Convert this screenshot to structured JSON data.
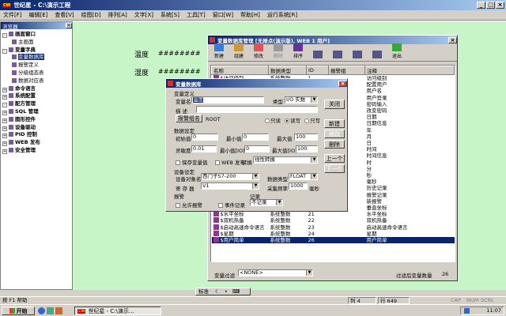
{
  "app": {
    "title": "世纪星 - C:\\演示工程",
    "title_icon": "cw-icon"
  },
  "menu": [
    "文件[F]",
    "编辑[E]",
    "查看[V]",
    "绘图[D]",
    "排列[A]",
    "文字[X]",
    "系统[S]",
    "工具[T]",
    "窗口[W]",
    "帮助[H]",
    "运行系统[R]"
  ],
  "browser": {
    "title": "浏览器",
    "items": [
      {
        "label": "画面窗口",
        "level": 0,
        "bold": true,
        "exp": "-"
      },
      {
        "label": "主画面",
        "level": 1
      },
      {
        "label": "变量字典",
        "level": 0,
        "bold": true,
        "exp": "-"
      },
      {
        "label": "变量数据库",
        "level": 1
      },
      {
        "label": "报警定义",
        "level": 1
      },
      {
        "label": "分级组态表",
        "level": 1
      },
      {
        "label": "数据对应表",
        "level": 1
      },
      {
        "label": "命令语言",
        "level": 0,
        "bold": true,
        "exp": "+"
      },
      {
        "label": "系统配置",
        "level": 0,
        "bold": true,
        "exp": "+"
      },
      {
        "label": "配方管理",
        "level": 0,
        "bold": true,
        "exp": "-"
      },
      {
        "label": "SQL 管理",
        "level": 0,
        "bold": true,
        "exp": "+"
      },
      {
        "label": "图形控件",
        "level": 0,
        "bold": true,
        "exp": "+"
      },
      {
        "label": "设备驱动",
        "level": 0,
        "bold": true,
        "exp": "+"
      },
      {
        "label": "PID 控制",
        "level": 0,
        "bold": true,
        "exp": "+"
      },
      {
        "label": "WEB 发布",
        "level": 0,
        "bold": true,
        "exp": "+"
      },
      {
        "label": "安全管理",
        "level": 0,
        "bold": true,
        "exp": "+"
      }
    ]
  },
  "canvas": {
    "temp_label": "温度",
    "temp_value": "########",
    "hum_label": "湿度",
    "hum_value": "########"
  },
  "dbmgr": {
    "title": "变量数据库管理 [无报点(演示版), WEB 1 用户]",
    "toolbar": [
      "新建",
      "组建",
      "修改",
      "删除",
      "排序",
      "",
      "",
      "",
      "",
      "退出"
    ],
    "columns": [
      "名称",
      "数据类型",
      "ID",
      "报警组",
      "注释"
    ],
    "rows": [
      [
        "$访问级别",
        "系统整数",
        "1",
        "",
        "访问级别"
      ],
      [
        "",
        "",
        "",
        "",
        "配置用户"
      ],
      [
        "",
        "",
        "",
        "",
        "用户名"
      ],
      [
        "",
        "",
        "",
        "",
        "用户登录"
      ],
      [
        "",
        "",
        "",
        "",
        "密码输入"
      ],
      [
        "",
        "",
        "",
        "",
        "改变密码"
      ],
      [
        "",
        "",
        "",
        "",
        "日期"
      ],
      [
        "",
        "",
        "",
        "",
        "日期信息"
      ],
      [
        "",
        "",
        "",
        "",
        "年"
      ],
      [
        "",
        "",
        "",
        "",
        "月"
      ],
      [
        "",
        "",
        "",
        "",
        "日"
      ],
      [
        "",
        "",
        "",
        "",
        "时间"
      ],
      [
        "",
        "",
        "",
        "",
        "时间信息"
      ],
      [
        "",
        "",
        "",
        "",
        "时"
      ],
      [
        "",
        "",
        "",
        "",
        "分"
      ],
      [
        "",
        "",
        "",
        "",
        "秒"
      ],
      [
        "",
        "",
        "",
        "",
        "毫秒"
      ],
      [
        "",
        "",
        "",
        "",
        "历史记录"
      ],
      [
        "",
        "",
        "",
        "",
        "报警记录"
      ],
      [
        "",
        "",
        "",
        "",
        "新报警"
      ],
      [
        "",
        "",
        "",
        "",
        "垂直坐标"
      ],
      [
        "$水平坐标",
        "系统整数",
        "21",
        "",
        "水平坐标"
      ],
      [
        "$双机热备",
        "系统整数",
        "22",
        "",
        "双机热备"
      ],
      [
        "$启动高速命令语言",
        "系统整数",
        "23",
        "",
        "启动高速命令语言"
      ],
      [
        "$星期",
        "系统整数",
        "24",
        "",
        "星期"
      ],
      [
        "$用户简单",
        "系统整数",
        "26",
        "",
        "用户简单"
      ]
    ],
    "filter_label": "变量过滤",
    "filter_value": "<NONE>",
    "count_label": "过滤后变量数量",
    "count_value": "26"
  },
  "dialog": {
    "title": "变量数据库",
    "def_group": "变量定义",
    "name_label": "变量名",
    "name_value": "温度",
    "type_label": "类型",
    "type_value": "I/O 实数",
    "desc_label": "描  述",
    "alarm_btn": "报警组名",
    "alarm_value": "ROOT",
    "r_readonly": "只读",
    "r_readwrite": "读写",
    "r_writeonly": "只写",
    "data_group": "数据设定",
    "init_label": "初始值",
    "init_value": "0",
    "min_label": "最小值",
    "min_value": "0",
    "max_label": "最大值",
    "max_value": "100",
    "dead_label": "灵敏度",
    "dead_value": "0.01",
    "minio_label": "最小值[IO]",
    "minio_value": "0",
    "maxio_label": "最大值[IO]",
    "maxio_value": "100",
    "save_label": "保存变量值",
    "web_label": "WEB 发布",
    "conv_label": "转换",
    "conv_value": "线性转换",
    "dev_group": "设备设定",
    "devobj_label": "设备对象名",
    "devobj_value": "西门子S7-200",
    "dtype_label": "数据类型",
    "dtype_value": "FLOAT",
    "reg_label": "寄 存 器",
    "reg_value": "V1",
    "freq_label": "采集频率",
    "freq_value": "1000",
    "freq_unit": "毫秒",
    "alarm_group": "报警",
    "allow_alarm": "允许报警",
    "event_label": "事件记录",
    "rec_group": "记录",
    "rec_value": "不记录",
    "btns": {
      "close": "关闭",
      "new": "新建",
      "modify": "修改",
      "delete": "删除",
      "prev": "上一个",
      "next": "下一个"
    }
  },
  "statusbar": {
    "help": "按 F1 帮助",
    "col_label": "列 4",
    "row_label": "行 649",
    "caps": "CAP",
    "num": "NUM",
    "scrl": "SCRL"
  },
  "taskbar": {
    "start": "开始",
    "task": "世纪星 - C:\\演示...",
    "time": "11:07",
    "ime": "标准"
  }
}
